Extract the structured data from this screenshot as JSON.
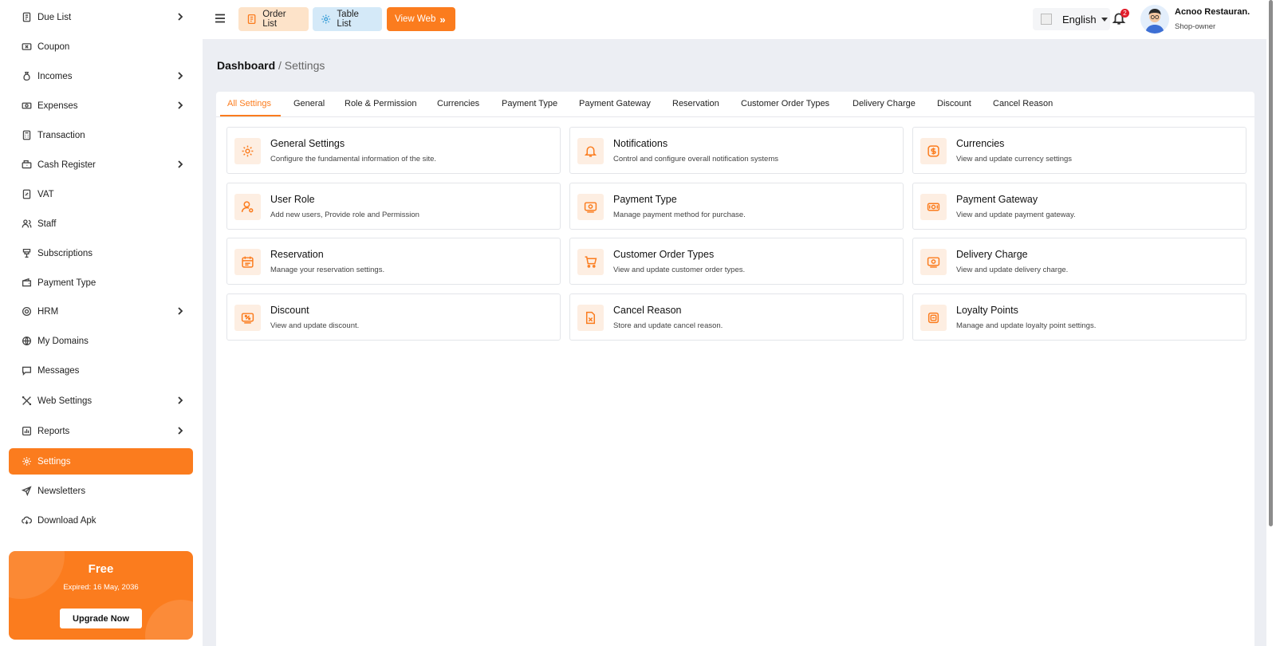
{
  "sidebar": {
    "items": [
      {
        "label": "Due List",
        "icon": "receipt-icon",
        "has_chevron": true
      },
      {
        "label": "Coupon",
        "icon": "coupon-icon",
        "has_chevron": false
      },
      {
        "label": "Incomes",
        "icon": "money-bag-icon",
        "has_chevron": true
      },
      {
        "label": "Expenses",
        "icon": "cash-icon",
        "has_chevron": true
      },
      {
        "label": "Transaction",
        "icon": "calculator-icon",
        "has_chevron": false
      },
      {
        "label": "Cash Register",
        "icon": "cash-register-icon",
        "has_chevron": true
      },
      {
        "label": "VAT",
        "icon": "vat-icon",
        "has_chevron": false
      },
      {
        "label": "Staff",
        "icon": "staff-icon",
        "has_chevron": false
      },
      {
        "label": "Subscriptions",
        "icon": "subscription-icon",
        "has_chevron": false
      },
      {
        "label": "Payment Type",
        "icon": "wallet-icon",
        "has_chevron": false
      },
      {
        "label": "HRM",
        "icon": "hrm-icon",
        "has_chevron": true
      },
      {
        "label": "My Domains",
        "icon": "globe-icon",
        "has_chevron": false
      },
      {
        "label": "Messages",
        "icon": "message-icon",
        "has_chevron": false
      },
      {
        "label": "Web Settings",
        "icon": "tools-icon",
        "has_chevron": true
      },
      {
        "label": "Reports",
        "icon": "report-icon",
        "has_chevron": true
      },
      {
        "label": "Settings",
        "icon": "gear-icon",
        "has_chevron": false,
        "active": true
      },
      {
        "label": "Newsletters",
        "icon": "send-icon",
        "has_chevron": false
      },
      {
        "label": "Download Apk",
        "icon": "cloud-download-icon",
        "has_chevron": false
      }
    ],
    "plan": {
      "name": "Free",
      "expiry": "Expired: 16 May, 2036",
      "upgrade_label": "Upgrade Now"
    }
  },
  "topbar": {
    "order_list_label": "Order List",
    "table_list_label": "Table List",
    "view_web_label": "View Web",
    "language": "English",
    "notification_count": "2",
    "user_name": "Acnoo Restauran.",
    "user_role": "Shop-owner"
  },
  "breadcrumb": {
    "main": "Dashboard",
    "separator": "/",
    "current": "Settings"
  },
  "tabs": [
    "All Settings",
    "General",
    "Role & Permission",
    "Currencies",
    "Payment Type",
    "Payment Gateway",
    "Reservation",
    "Customer Order Types",
    "Delivery Charge",
    "Discount",
    "Cancel Reason"
  ],
  "active_tab": "All Settings",
  "cards": [
    {
      "title": "General Settings",
      "desc": "Configure the fundamental information of the site.",
      "icon": "gear-icon"
    },
    {
      "title": "Notifications",
      "desc": "Control and configure overall notification systems",
      "icon": "bell-icon"
    },
    {
      "title": "Currencies",
      "desc": "View and update currency settings",
      "icon": "dollar-icon"
    },
    {
      "title": "User Role",
      "desc": "Add new users, Provide role and Permission",
      "icon": "user-gear-icon"
    },
    {
      "title": "Payment Type",
      "desc": "Manage payment method for purchase.",
      "icon": "payment-icon"
    },
    {
      "title": "Payment Gateway",
      "desc": "View and update payment gateway.",
      "icon": "gateway-icon"
    },
    {
      "title": "Reservation",
      "desc": "Manage your reservation settings.",
      "icon": "calendar-icon"
    },
    {
      "title": "Customer Order Types",
      "desc": "View and update customer order types.",
      "icon": "cart-icon"
    },
    {
      "title": "Delivery Charge",
      "desc": "View and update delivery charge.",
      "icon": "delivery-icon"
    },
    {
      "title": "Discount",
      "desc": "View and update discount.",
      "icon": "discount-icon"
    },
    {
      "title": "Cancel Reason",
      "desc": "Store and update cancel reason.",
      "icon": "cancel-document-icon"
    },
    {
      "title": "Loyalty Points",
      "desc": "Manage and update loyalty point settings.",
      "icon": "loyalty-icon"
    }
  ],
  "colors": {
    "accent": "#fb7c1e",
    "icon_bg": "#fdeee2",
    "page_bg": "#eceef3"
  }
}
